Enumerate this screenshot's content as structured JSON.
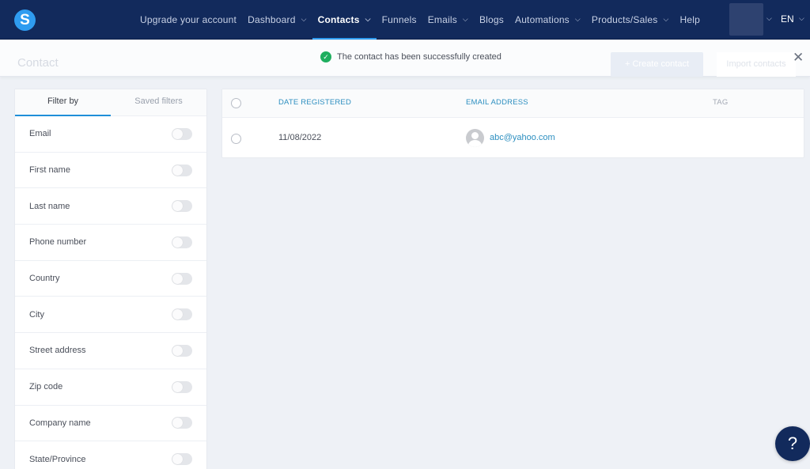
{
  "nav": {
    "logo_letter": "S",
    "items": [
      {
        "label": "Upgrade your account",
        "has_dropdown": false,
        "active": false
      },
      {
        "label": "Dashboard",
        "has_dropdown": true,
        "active": false
      },
      {
        "label": "Contacts",
        "has_dropdown": true,
        "active": true
      },
      {
        "label": "Funnels",
        "has_dropdown": false,
        "active": false
      },
      {
        "label": "Emails",
        "has_dropdown": true,
        "active": false
      },
      {
        "label": "Blogs",
        "has_dropdown": false,
        "active": false
      },
      {
        "label": "Automations",
        "has_dropdown": true,
        "active": false
      },
      {
        "label": "Products/Sales",
        "has_dropdown": true,
        "active": false
      },
      {
        "label": "Help",
        "has_dropdown": false,
        "active": false
      }
    ],
    "language": "EN",
    "chevron": "⌄"
  },
  "subheader": {
    "page_title": "Contact",
    "create_button": "+ Create contact",
    "import_button": "Import contacts"
  },
  "toast": {
    "message": "The contact has been successfully created",
    "icon": "✓",
    "close": "✕"
  },
  "filters": {
    "tabs": [
      {
        "label": "Filter by",
        "active": true
      },
      {
        "label": "Saved filters",
        "active": false
      }
    ],
    "items": [
      {
        "label": "Email",
        "enabled": false
      },
      {
        "label": "First name",
        "enabled": false
      },
      {
        "label": "Last name",
        "enabled": false
      },
      {
        "label": "Phone number",
        "enabled": false
      },
      {
        "label": "Country",
        "enabled": false
      },
      {
        "label": "City",
        "enabled": false
      },
      {
        "label": "Street address",
        "enabled": false
      },
      {
        "label": "Zip code",
        "enabled": false
      },
      {
        "label": "Company name",
        "enabled": false
      },
      {
        "label": "State/Province",
        "enabled": false
      }
    ]
  },
  "table": {
    "columns": [
      "DATE REGISTERED",
      "EMAIL ADDRESS",
      "TAG"
    ],
    "rows": [
      {
        "date_registered": "11/08/2022",
        "email": "abc@yahoo.com",
        "tag": ""
      }
    ]
  },
  "help_button": "?",
  "colors": {
    "nav_bg": "#122a5c",
    "accent": "#2f9cf0",
    "success": "#1fae5f",
    "link": "#2d8fc0"
  }
}
